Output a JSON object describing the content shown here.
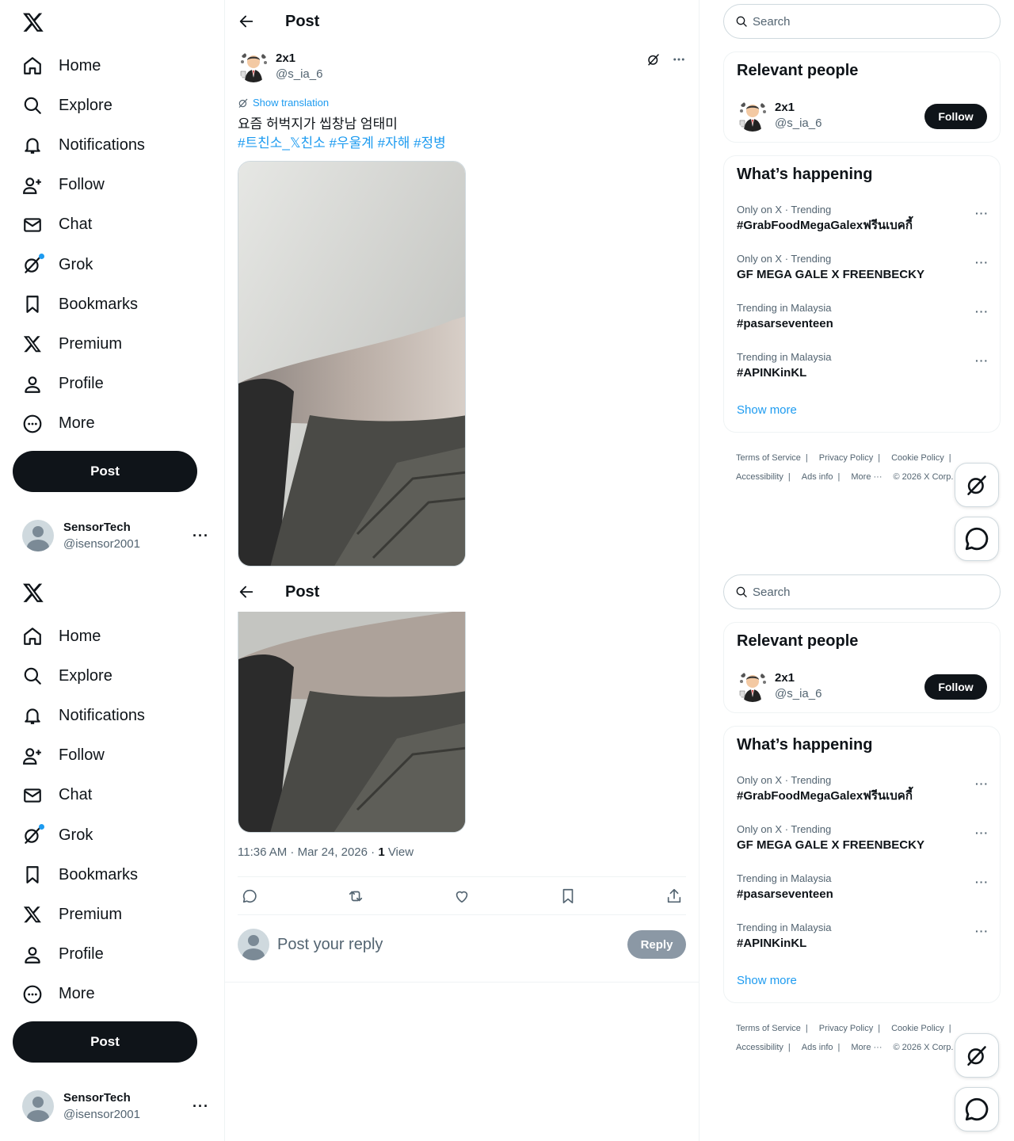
{
  "nav": {
    "items": [
      {
        "label": "Home",
        "icon": "home-icon"
      },
      {
        "label": "Explore",
        "icon": "search-icon"
      },
      {
        "label": "Notifications",
        "icon": "bell-icon"
      },
      {
        "label": "Follow",
        "icon": "add-user-icon"
      },
      {
        "label": "Chat",
        "icon": "envelope-icon"
      },
      {
        "label": "Grok",
        "icon": "grok-icon"
      },
      {
        "label": "Bookmarks",
        "icon": "bookmark-icon"
      },
      {
        "label": "Premium",
        "icon": "x-logo-icon"
      },
      {
        "label": "Profile",
        "icon": "person-icon"
      },
      {
        "label": "More",
        "icon": "more-circle-icon"
      }
    ],
    "post_label": "Post"
  },
  "account": {
    "name": "SensorTech",
    "handle": "@isensor2001",
    "more": "···"
  },
  "header": {
    "title": "Post"
  },
  "tweet": {
    "author_name": "2x1",
    "author_handle": "@s_ia_6",
    "show_translation": "Show translation",
    "text": "요즘 허벅지가 씹창남 엄태미",
    "hashtags": "#트친소_𝕏친소 #우울계 #자해 #정병",
    "time": "11:36 AM · Mar 24, 2026 · ",
    "views_count": "1",
    "views_label": " View"
  },
  "reply": {
    "placeholder": "Post your reply",
    "button": "Reply"
  },
  "search": {
    "placeholder": "Search"
  },
  "relevant": {
    "title": "Relevant people",
    "name": "2x1",
    "handle": "@s_ia_6",
    "follow": "Follow"
  },
  "trends": {
    "title": "What’s happening",
    "items": [
      {
        "meta": "Only on X · Trending",
        "name": "#GrabFoodMegaGalexฟรีนเบคกี้"
      },
      {
        "meta": "Only on X · Trending",
        "name": "GF MEGA GALE X FREENBECKY"
      },
      {
        "meta": "Trending in Malaysia",
        "name": "#pasarseventeen"
      },
      {
        "meta": "Trending in Malaysia",
        "name": "#APINKinKL"
      }
    ],
    "show_more": "Show more"
  },
  "footer": {
    "terms": "Terms of Service",
    "privacy": "Privacy Policy",
    "cookie": "Cookie Policy",
    "accessibility": "Accessibility",
    "ads": "Ads info",
    "more": "More ···",
    "copyright": "© 2026 X Corp."
  },
  "colors": {
    "accent": "#1d9bf0",
    "text": "#0f1419",
    "muted": "#536471"
  }
}
